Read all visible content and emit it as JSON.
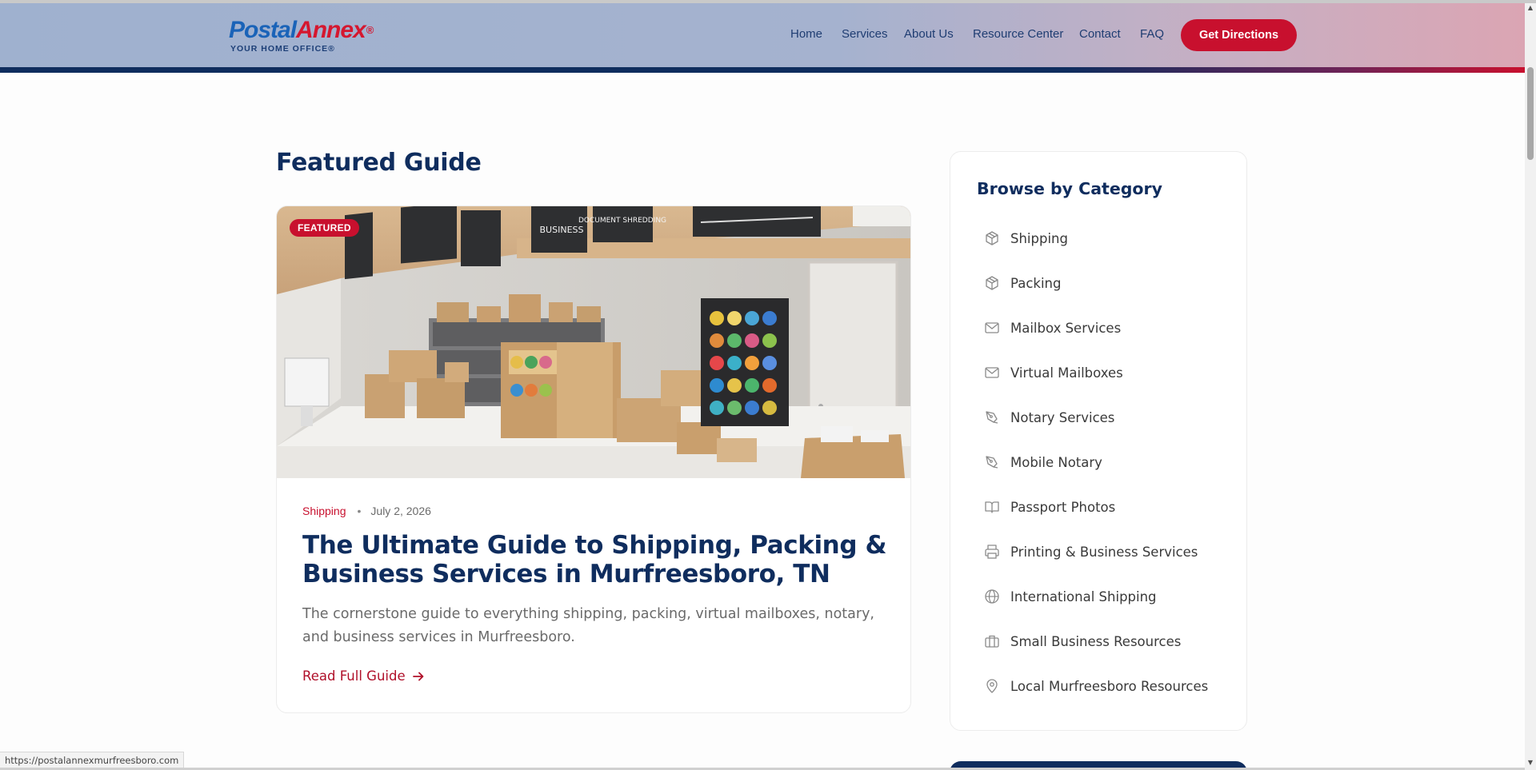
{
  "brand": {
    "name_part1": "Postal",
    "name_part2": "Annex",
    "registered": "®",
    "tagline": "YOUR HOME OFFICE®"
  },
  "nav": {
    "items": [
      {
        "label": "Home"
      },
      {
        "label": "Services"
      },
      {
        "label": "About Us"
      },
      {
        "label": "Resource Center"
      },
      {
        "label": "Contact"
      },
      {
        "label": "FAQ"
      }
    ],
    "cta_label": "Get Directions"
  },
  "featured": {
    "section_title": "Featured Guide",
    "badge": "FEATURED",
    "category": "Shipping",
    "separator": "•",
    "date": "July 2, 2026",
    "title": "The Ultimate Guide to Shipping, Packing & Business Services in Murfreesboro, TN",
    "excerpt": "The cornerstone guide to everything shipping, packing, virtual mailboxes, notary, and business services in Murfreesboro.",
    "read_more": "Read Full Guide",
    "image_signs": {
      "business": "BUSINESS",
      "shredding": "DOCUMENT SHREDDING"
    }
  },
  "sidebar": {
    "title": "Browse by Category",
    "categories": [
      {
        "label": "Shipping",
        "icon": "box-icon"
      },
      {
        "label": "Packing",
        "icon": "box-icon"
      },
      {
        "label": "Mailbox Services",
        "icon": "mail-icon"
      },
      {
        "label": "Virtual Mailboxes",
        "icon": "mail-icon"
      },
      {
        "label": "Notary Services",
        "icon": "pen-icon"
      },
      {
        "label": "Mobile Notary",
        "icon": "pen-icon"
      },
      {
        "label": "Passport Photos",
        "icon": "book-icon"
      },
      {
        "label": "Printing & Business Services",
        "icon": "printer-icon"
      },
      {
        "label": "International Shipping",
        "icon": "globe-icon"
      },
      {
        "label": "Small Business Resources",
        "icon": "building-icon"
      },
      {
        "label": "Local Murfreesboro Resources",
        "icon": "map-pin-icon"
      }
    ]
  },
  "status_bar": {
    "url": "https://postalannexmurfreesboro.com"
  },
  "colors": {
    "navy": "#0f2d5e",
    "red": "#c8102e",
    "logo_blue": "#1a63b8"
  }
}
